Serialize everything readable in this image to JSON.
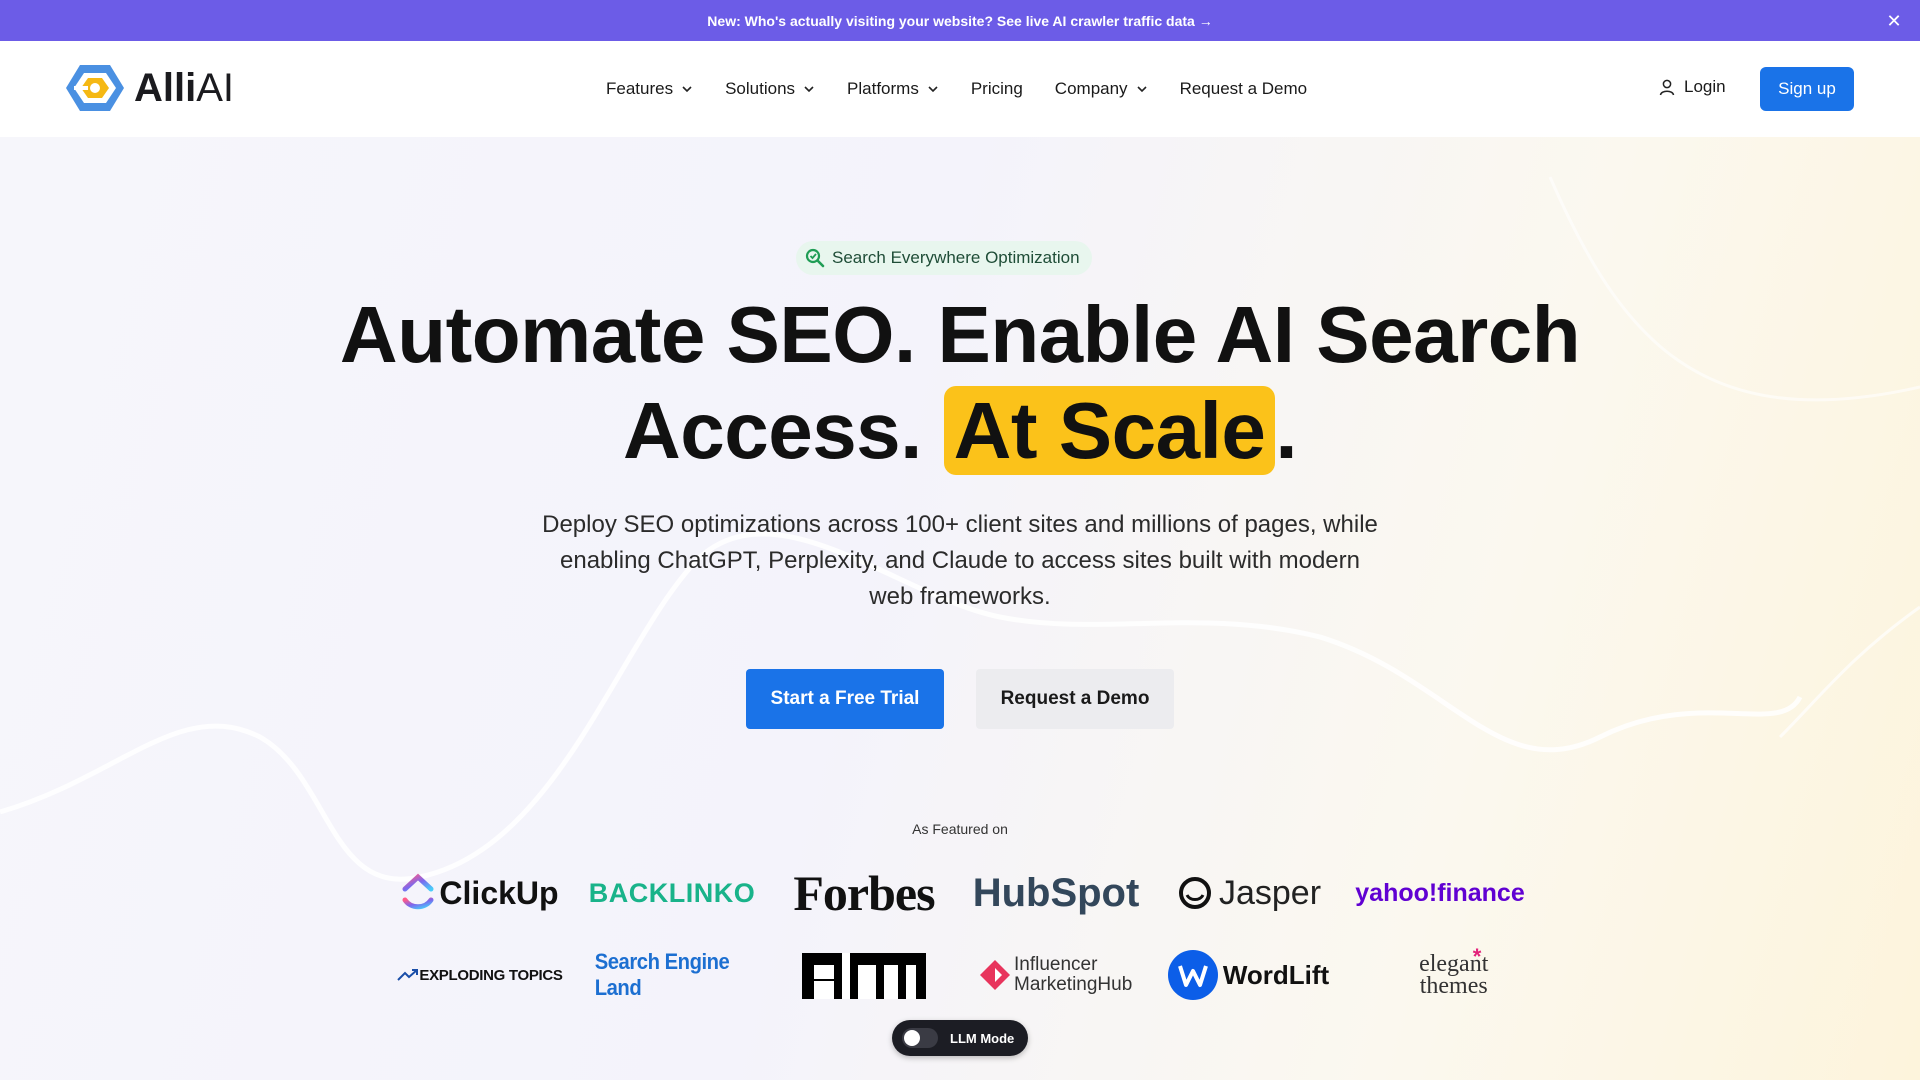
{
  "announcement": {
    "text": "New: Who's actually visiting your website? See live AI crawler traffic data →",
    "close_icon": "close-icon"
  },
  "nav": {
    "logo_text_a": "Alli",
    "logo_text_b": "AI",
    "items": [
      {
        "label": "Features",
        "has_menu": true
      },
      {
        "label": "Solutions",
        "has_menu": true
      },
      {
        "label": "Platforms",
        "has_menu": true
      },
      {
        "label": "Pricing",
        "has_menu": false
      },
      {
        "label": "Company",
        "has_menu": true
      },
      {
        "label": "Request a Demo",
        "has_menu": false
      }
    ],
    "login_label": "Login",
    "signup_label": "Sign up"
  },
  "hero": {
    "pill_label": "Search Everywhere Optimization",
    "headline_line1": "Automate SEO. Enable AI Search",
    "headline_line2_prefix": "Access. ",
    "headline_highlight": "At Scale",
    "headline_suffix": ".",
    "subheadline": "Deploy SEO optimizations across 100+ client sites and millions of pages, while enabling ChatGPT, Perplexity, and Claude to access sites built with modern web frameworks.",
    "cta_primary": "Start a Free Trial",
    "cta_secondary": "Request a Demo",
    "accent_color": "#1a73e8",
    "highlight_color": "#fbc21a"
  },
  "featured": {
    "label": "As Featured on",
    "row1": [
      "ClickUp",
      "BACKLINKO",
      "Forbes",
      "HubSpot",
      "Jasper",
      "yahoo!finance"
    ],
    "row2": [
      "EXPLODING TOPICS",
      "Search Engine Land",
      "aim",
      "Influencer MarketingHub",
      "WordLift",
      "elegant themes"
    ]
  },
  "llm_mode": {
    "label": "LLM Mode",
    "enabled": false
  }
}
